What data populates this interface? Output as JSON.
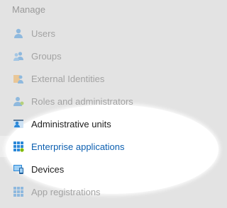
{
  "section": {
    "title": "Manage"
  },
  "nav": {
    "users": "Users",
    "groups": "Groups",
    "external_identities": "External Identities",
    "roles": "Roles and administrators",
    "admin_units": "Administrative units",
    "enterprise_apps": "Enterprise applications",
    "devices": "Devices",
    "app_registrations": "App registrations"
  },
  "selected_item": "Enterprise applications",
  "colors": {
    "background": "#e3e3e3",
    "highlight": "#ffffff",
    "selected_text": "#0c5fb0",
    "active_text": "#1e1e1e",
    "dimmed_text": "#a3a3a3"
  }
}
